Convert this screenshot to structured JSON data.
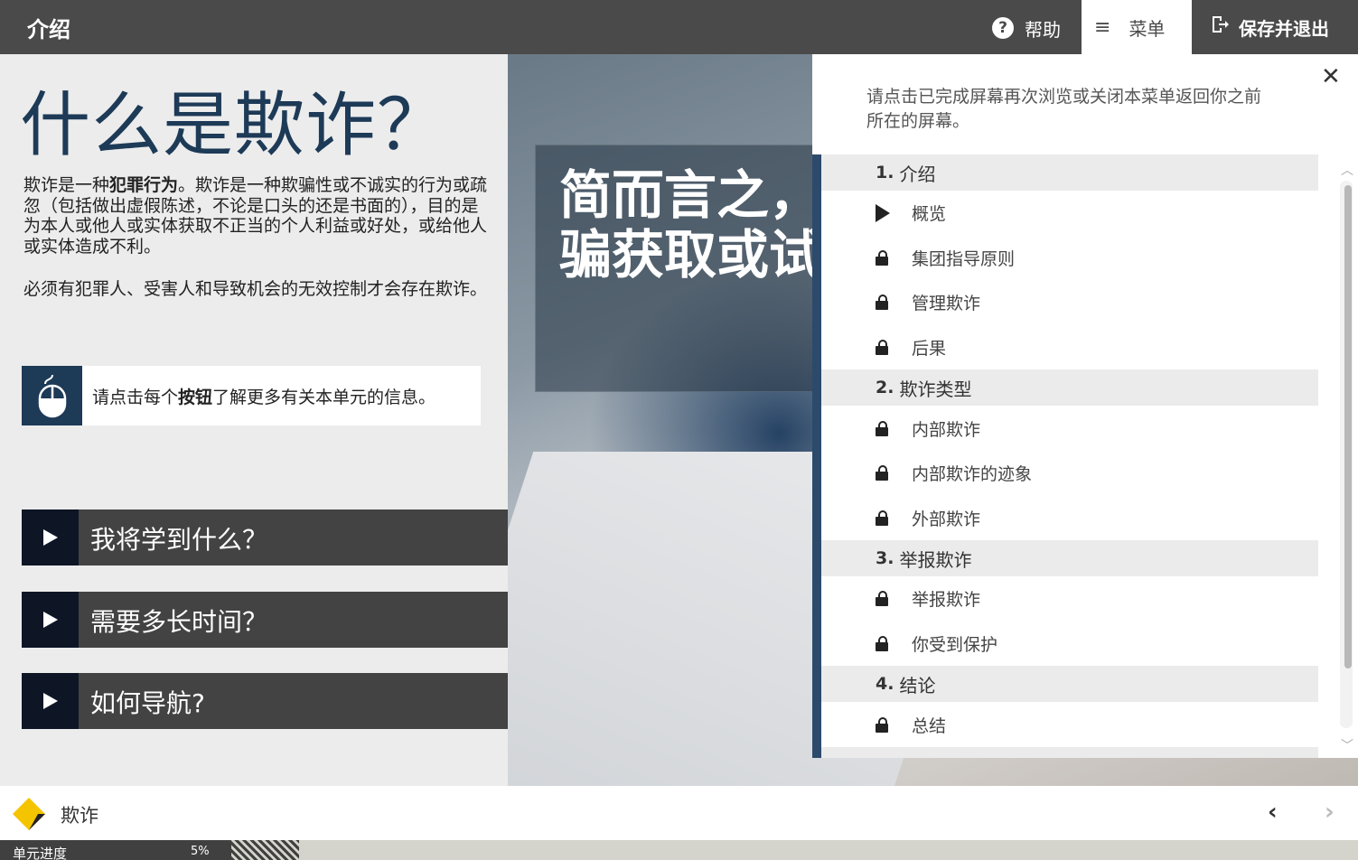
{
  "header": {
    "title": "介绍",
    "help_label": "帮助",
    "menu_label": "菜单",
    "save_exit_label": "保存并退出"
  },
  "content": {
    "headline": "什么是欺诈？",
    "para1_a": "欺诈是一种",
    "para1_bold": "犯罪行为",
    "para1_b": "。欺诈是一种欺骗性或不诚实的行为或疏忽（包括做出虚假陈述，不论是口头的还是书面的），目的是为本人或他人或实体获取不正当的个人利益或好处，或给他人或实体造成不利。",
    "para2": "必须有犯罪人、受害人和导致机会的无效控制才会存在欺诈。",
    "hint_a": "请点击每个",
    "hint_bold": "按钮",
    "hint_b": "了解更多有关本单元的信息。",
    "accordion": [
      "我将学到什么？",
      "需要多长时间？",
      "如何导航?"
    ],
    "quote_lines": [
      "简而言之，",
      "骗获取或试"
    ]
  },
  "menu": {
    "intro": "请点击已完成屏幕再次浏览或关闭本菜单返回你之前所在的屏幕。",
    "sections": [
      {
        "num": "1.",
        "title": "介绍",
        "items": [
          {
            "label": "概览",
            "icon": "play-icon"
          },
          {
            "label": "集团指导原则",
            "icon": "lock-icon"
          },
          {
            "label": "管理欺诈",
            "icon": "lock-icon"
          },
          {
            "label": "后果",
            "icon": "lock-icon"
          }
        ]
      },
      {
        "num": "2.",
        "title": "欺诈类型",
        "items": [
          {
            "label": "内部欺诈",
            "icon": "lock-icon"
          },
          {
            "label": "内部欺诈的迹象",
            "icon": "lock-icon"
          },
          {
            "label": "外部欺诈",
            "icon": "lock-icon"
          }
        ]
      },
      {
        "num": "3.",
        "title": "举报欺诈",
        "items": [
          {
            "label": "举报欺诈",
            "icon": "lock-icon"
          },
          {
            "label": "你受到保护",
            "icon": "lock-icon"
          }
        ]
      },
      {
        "num": "4.",
        "title": "结论",
        "items": [
          {
            "label": "总结",
            "icon": "lock-icon"
          }
        ]
      }
    ]
  },
  "footer": {
    "course_name": "欺诈",
    "progress_label": "单元进度",
    "progress_value": "5%",
    "progress_fraction": 0.05
  },
  "colors": {
    "headline": "#1d3a57",
    "topbar": "#4a4a4a",
    "accordion": "#434343",
    "logo": "#f5c400"
  }
}
